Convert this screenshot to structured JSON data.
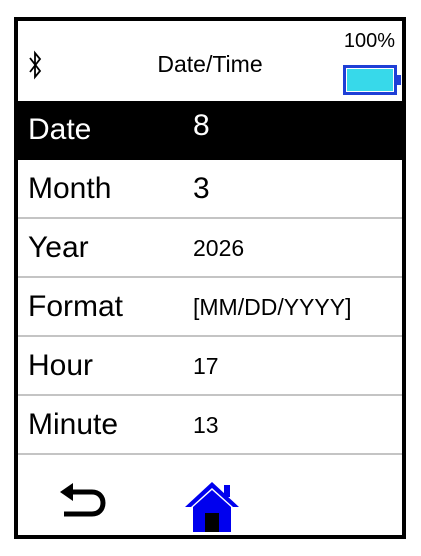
{
  "status": {
    "title": "Date/Time",
    "battery_percent": "100%",
    "battery_level": 1.0,
    "bluetooth_icon": "bluetooth-icon",
    "battery_icon": "battery-icon"
  },
  "menu": {
    "rows": [
      {
        "label": "Date",
        "value": "8"
      },
      {
        "label": "Month",
        "value": "3"
      },
      {
        "label": "Year",
        "value": "2026"
      },
      {
        "label": "Format",
        "value": "[MM/DD/YYYY]"
      },
      {
        "label": "Hour",
        "value": "17"
      },
      {
        "label": "Minute",
        "value": "13"
      }
    ],
    "selected_index": 0
  },
  "footer": {
    "back_icon": "back-arrow-icon",
    "home_icon": "home-icon"
  },
  "colors": {
    "selected_bg": "#000000",
    "selected_text": "#ffffff",
    "battery_fill": "#37d9ea",
    "battery_outline": "#1f3fd6",
    "home_icon": "#0000ee",
    "divider": "#c4c4c4"
  }
}
